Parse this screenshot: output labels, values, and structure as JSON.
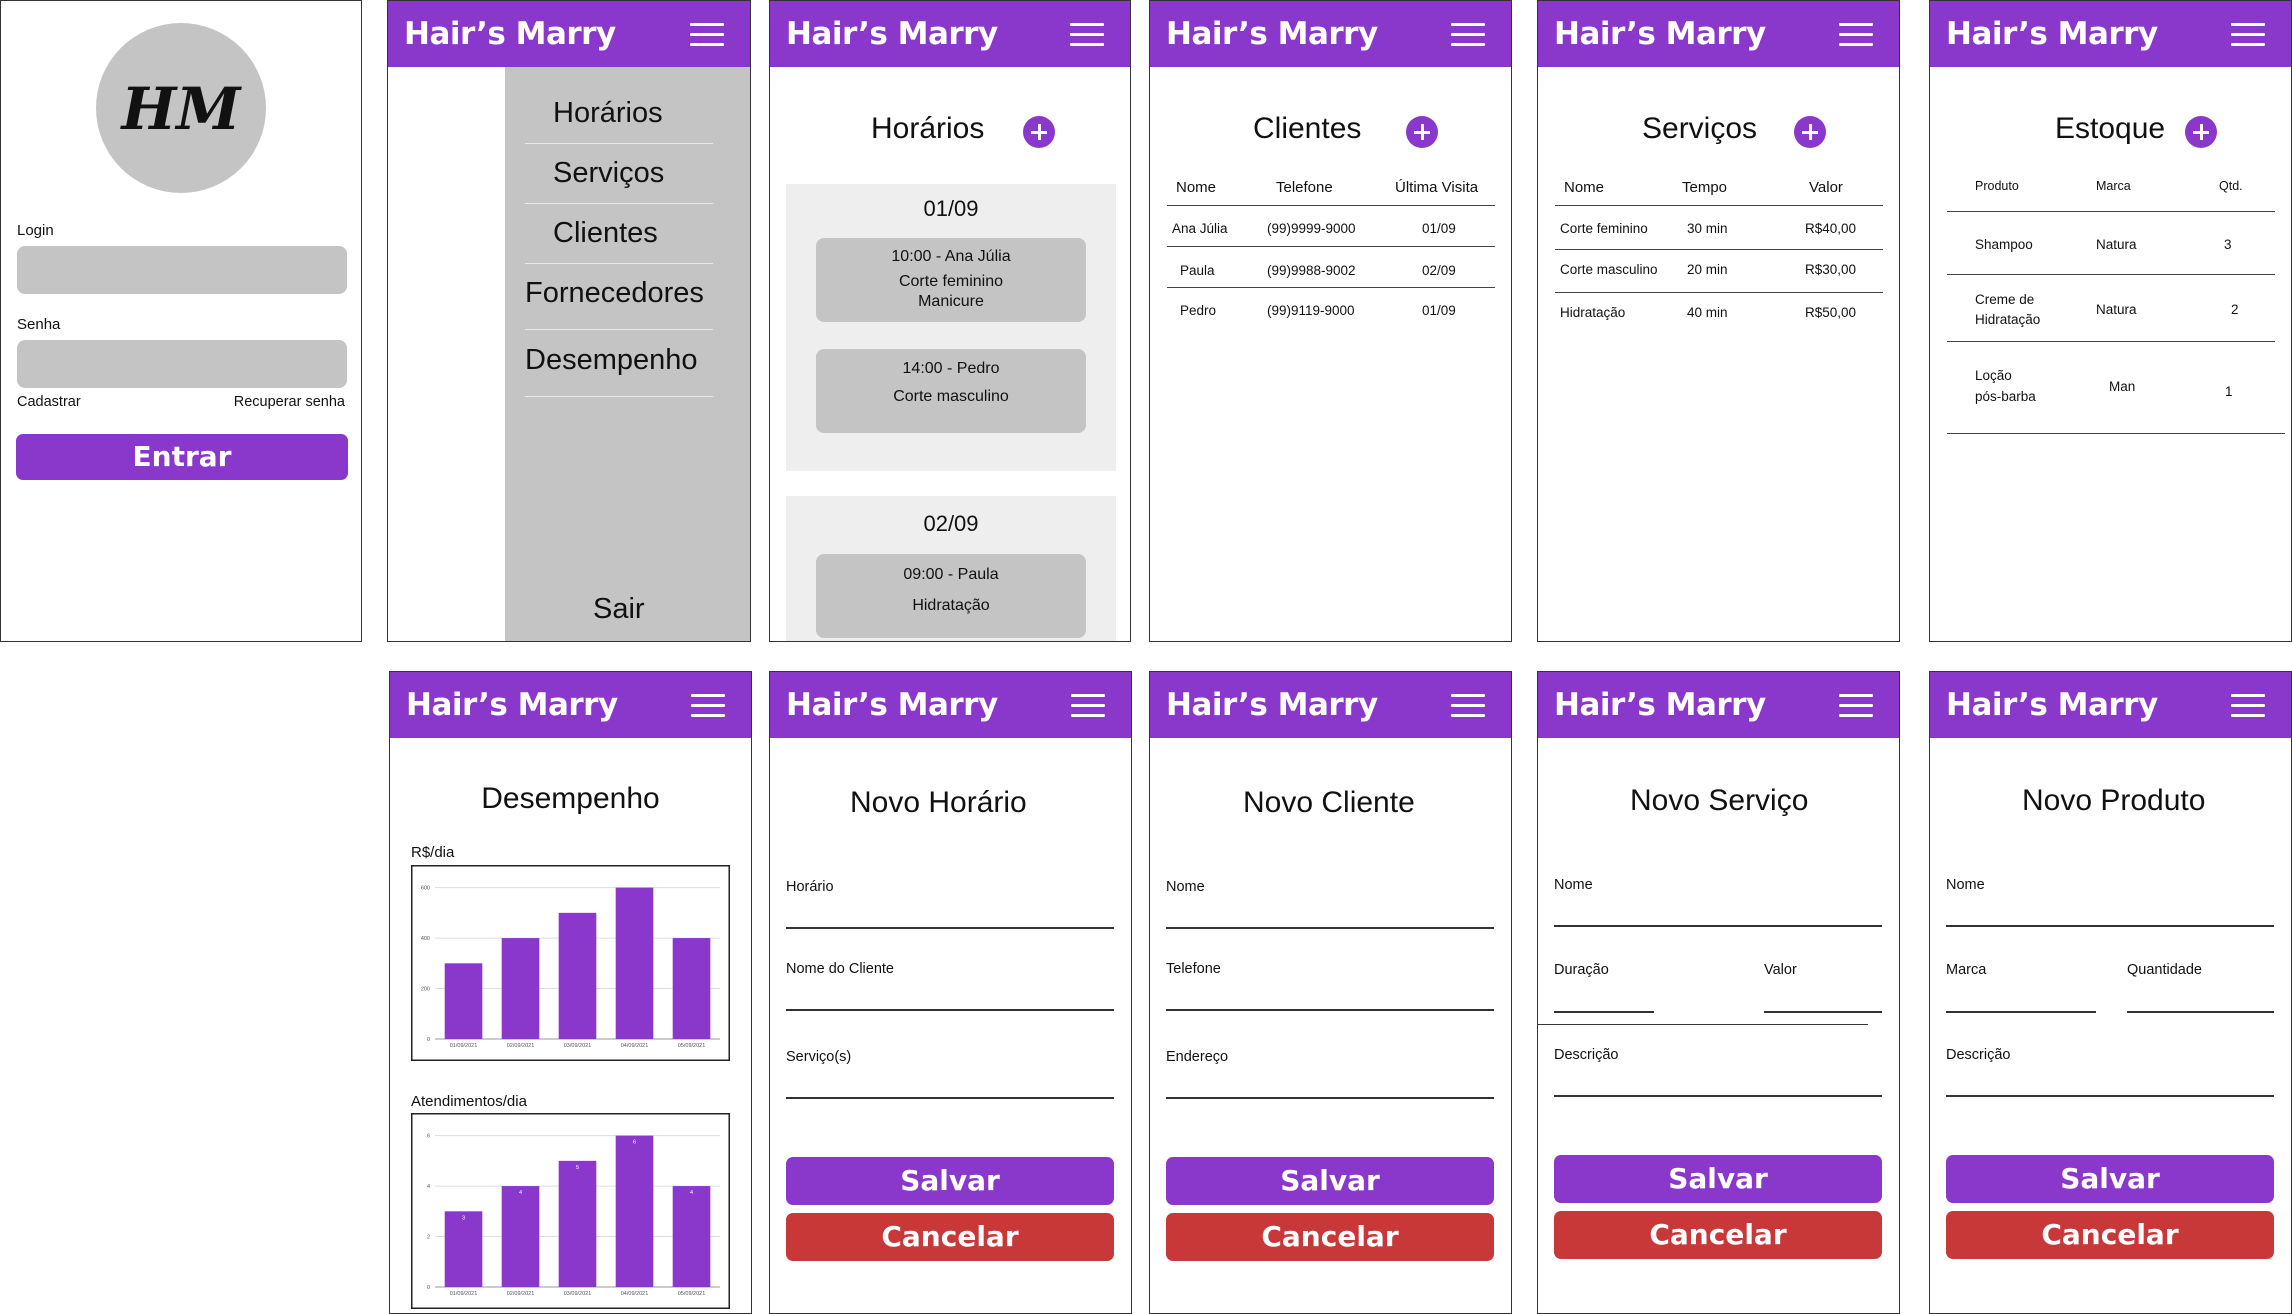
{
  "app": {
    "brand": "Hair’s Marry"
  },
  "colors": {
    "accent": "#8a38cc",
    "danger": "#c93838",
    "field": "#c4c4c4"
  },
  "login": {
    "logo": "HM",
    "login_label": "Login",
    "password_label": "Senha",
    "register_link": "Cadastrar",
    "recover_link": "Recuperar senha",
    "submit": "Entrar"
  },
  "menu": {
    "items": [
      "Horários",
      "Serviços",
      "Clientes",
      "Fornecedores",
      "Desempenho"
    ],
    "logout": "Sair"
  },
  "schedule": {
    "title": "Horários",
    "days": [
      {
        "date": "01/09",
        "items": [
          {
            "line1": "10:00 - Ana Júlia",
            "line2": "Corte feminino",
            "line3": "Manicure"
          },
          {
            "line1": "14:00 - Pedro",
            "line2": "Corte masculino"
          }
        ]
      },
      {
        "date": "02/09",
        "items": [
          {
            "line1": "09:00 - Paula",
            "line2": "Hidratação"
          }
        ]
      }
    ]
  },
  "clients": {
    "title": "Clientes",
    "headers": [
      "Nome",
      "Telefone",
      "Última Visita"
    ],
    "rows": [
      [
        "Ana Júlia",
        "(99)9999-9000",
        "01/09"
      ],
      [
        "Paula",
        "(99)9988-9002",
        "02/09"
      ],
      [
        "Pedro",
        "(99)9119-9000",
        "01/09"
      ]
    ]
  },
  "services": {
    "title": "Serviços",
    "headers": [
      "Nome",
      "Tempo",
      "Valor"
    ],
    "rows": [
      [
        "Corte feminino",
        "30 min",
        "R$40,00"
      ],
      [
        "Corte masculino",
        "20 min",
        "R$30,00"
      ],
      [
        "Hidratação",
        "40 min",
        "R$50,00"
      ]
    ]
  },
  "stock": {
    "title": "Estoque",
    "headers": [
      "Produto",
      "Marca",
      "Qtd."
    ],
    "rows": [
      {
        "p1": "Shampoo",
        "p2": "",
        "brand": "Natura",
        "qty": "3"
      },
      {
        "p1": "Creme de",
        "p2": "Hidratação",
        "brand": "Natura",
        "qty": "2"
      },
      {
        "p1": "Loção",
        "p2": "pós-barba",
        "brand": "Man",
        "qty": "1"
      }
    ]
  },
  "performance": {
    "title": "Desempenho"
  },
  "chart_data": [
    {
      "type": "bar",
      "title": "R$/dia",
      "categories": [
        "01/09/2021",
        "02/09/2021",
        "03/09/2021",
        "04/09/2021",
        "05/09/2021"
      ],
      "values": [
        300,
        400,
        500,
        600,
        400
      ],
      "yticks": [
        "0",
        "200",
        "400",
        "600"
      ],
      "ylim": [
        0,
        650
      ],
      "grid": true
    },
    {
      "type": "bar",
      "title": "Atendimentos/dia",
      "categories": [
        "01/09/2021",
        "02/09/2021",
        "03/09/2021",
        "04/09/2021",
        "05/09/2021"
      ],
      "values": [
        3,
        4,
        5,
        6,
        4
      ],
      "value_labels": [
        "3",
        "4",
        "5",
        "6",
        "4"
      ],
      "yticks": [
        "0",
        "2",
        "4",
        "6"
      ],
      "ylim": [
        0,
        6.5
      ],
      "grid": true
    }
  ],
  "forms": {
    "save": "Salvar",
    "cancel": "Cancelar",
    "new_schedule": {
      "title": "Novo Horário",
      "f1": "Horário",
      "f2": "Nome do Cliente",
      "f3": "Serviço(s)"
    },
    "new_client": {
      "title": "Novo Cliente",
      "f1": "Nome",
      "f2": "Telefone",
      "f3": "Endereço"
    },
    "new_service": {
      "title": "Novo Serviço",
      "f1": "Nome",
      "f2a": "Duração",
      "f2b": "Valor",
      "f3": "Descrição"
    },
    "new_product": {
      "title": "Novo Produto",
      "f1": "Nome",
      "f2a": "Marca",
      "f2b": "Quantidade",
      "f3": "Descrição"
    }
  }
}
